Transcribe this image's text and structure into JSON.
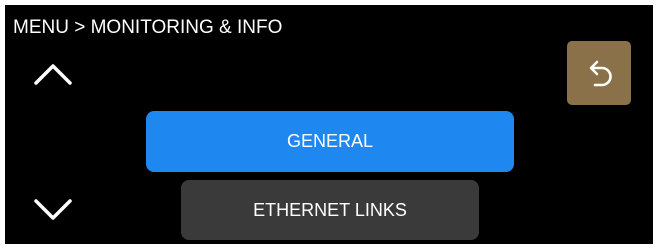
{
  "header": {
    "breadcrumb": "MENU > MONITORING & INFO"
  },
  "navigation": {
    "up_icon": "chevron-up-icon",
    "down_icon": "chevron-down-icon",
    "back_icon": "back-arrow-icon"
  },
  "menu": {
    "items": [
      {
        "label": "GENERAL",
        "selected": true
      },
      {
        "label": "ETHERNET LINKS",
        "selected": false
      }
    ]
  },
  "colors": {
    "background": "#000000",
    "text": "#ffffff",
    "selected_item": "#1e87f0",
    "unselected_item": "#3a3a3a",
    "back_button": "#8b7149"
  }
}
